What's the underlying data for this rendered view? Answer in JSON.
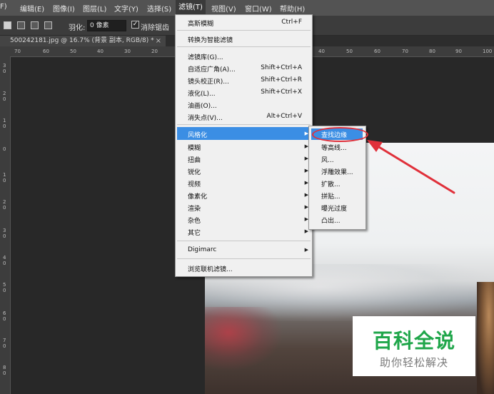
{
  "menubar": {
    "items": [
      "F)",
      "编辑(E)",
      "图像(I)",
      "图层(L)",
      "文字(Y)",
      "选择(S)",
      "滤镜(T)",
      "视图(V)",
      "窗口(W)",
      "帮助(H)"
    ]
  },
  "options": {
    "feather_label": "羽化:",
    "feather_value": "0 像素",
    "antialias_label": "消除锯齿"
  },
  "document": {
    "tab_title": "500242181.jpg @ 16.7% (背景 副本, RGB/8) *",
    "tab_close": "×"
  },
  "rulers": {
    "top": [
      "70",
      "60",
      "50",
      "40",
      "30",
      "20",
      "40",
      "50",
      "60",
      "70",
      "80",
      "90",
      "100"
    ],
    "left": [
      "3\n0",
      "2\n0",
      "1\n0",
      "0",
      "1\n0",
      "2\n0",
      "3\n0",
      "4\n0",
      "5\n0",
      "6\n0",
      "7\n0",
      "8\n0"
    ]
  },
  "filter_menu": {
    "last_filter": {
      "label": "高斯模糊",
      "shortcut": "Ctrl+F"
    },
    "smart": {
      "label": "转换为智能滤镜"
    },
    "gallery": {
      "label": "滤镜库(G)..."
    },
    "adaptive": {
      "label": "自适应广角(A)...",
      "shortcut": "Shift+Ctrl+A"
    },
    "lens": {
      "label": "镜头校正(R)...",
      "shortcut": "Shift+Ctrl+R"
    },
    "liquify": {
      "label": "液化(L)...",
      "shortcut": "Shift+Ctrl+X"
    },
    "oil": {
      "label": "油画(O)..."
    },
    "vanish": {
      "label": "消失点(V)...",
      "shortcut": "Alt+Ctrl+V"
    },
    "stylize": {
      "label": "风格化"
    },
    "blur": {
      "label": "模糊"
    },
    "distort": {
      "label": "扭曲"
    },
    "sharpen": {
      "label": "锐化"
    },
    "video": {
      "label": "视频"
    },
    "pixelate": {
      "label": "像素化"
    },
    "render": {
      "label": "渲染"
    },
    "noise": {
      "label": "杂色"
    },
    "other": {
      "label": "其它"
    },
    "digimarc": {
      "label": "Digimarc"
    },
    "browse": {
      "label": "浏览联机滤镜..."
    }
  },
  "submenu": {
    "items": [
      "查找边缘",
      "等高线...",
      "风...",
      "浮雕效果...",
      "扩散...",
      "拼贴...",
      "曝光过度",
      "凸出..."
    ]
  },
  "watermark": {
    "title": "百科全说",
    "subtitle": "助你轻松解决"
  },
  "colors": {
    "highlight": "#3b8ee4",
    "annotation_red": "#e0303a",
    "watermark_green": "#1fa64a"
  }
}
